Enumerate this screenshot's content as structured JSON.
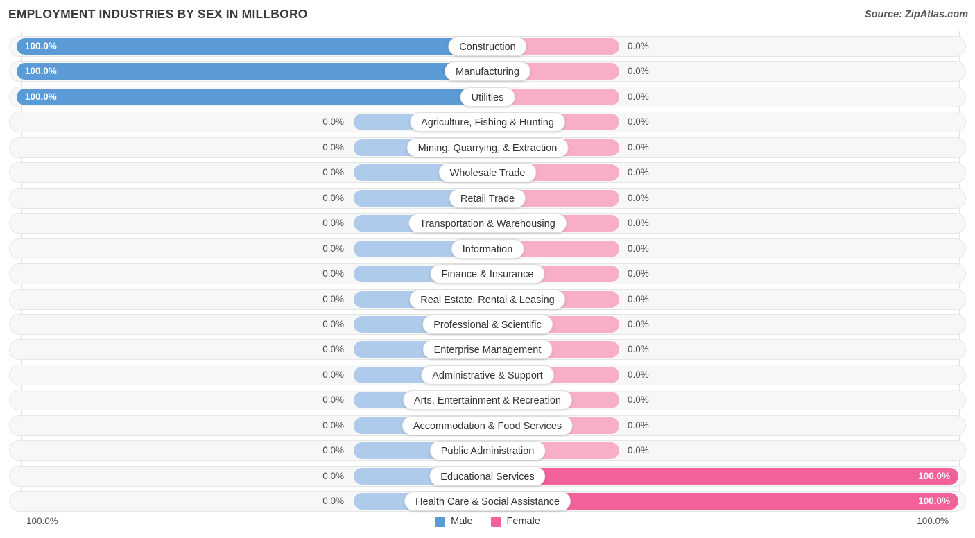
{
  "header": {
    "title": "EMPLOYMENT INDUSTRIES BY SEX IN MILLBORO",
    "source": "Source: ZipAtlas.com"
  },
  "legend": {
    "male_label": "Male",
    "female_label": "Female",
    "male_color": "#5b9bd5",
    "female_color": "#f2629a"
  },
  "footer": {
    "axis_left": "100.0%",
    "axis_right": "100.0%"
  },
  "chart_data": {
    "type": "bar",
    "subtype": "diverging-horizontal-bar",
    "title": "EMPLOYMENT INDUSTRIES BY SEX IN MILLBORO",
    "xlabel": "",
    "ylabel": "",
    "xlim": [
      100.0,
      100.0
    ],
    "grid": true,
    "legend_position": "bottom-center",
    "axis_extremes": [
      "100.0%",
      "100.0%"
    ],
    "categories": [
      "Construction",
      "Manufacturing",
      "Utilities",
      "Agriculture, Fishing & Hunting",
      "Mining, Quarrying, & Extraction",
      "Wholesale Trade",
      "Retail Trade",
      "Transportation & Warehousing",
      "Information",
      "Finance & Insurance",
      "Real Estate, Rental & Leasing",
      "Professional & Scientific",
      "Enterprise Management",
      "Administrative & Support",
      "Arts, Entertainment & Recreation",
      "Accommodation & Food Services",
      "Public Administration",
      "Educational Services",
      "Health Care & Social Assistance"
    ],
    "series": [
      {
        "name": "Male",
        "color": "#5b9bd5",
        "values": [
          100.0,
          100.0,
          100.0,
          0.0,
          0.0,
          0.0,
          0.0,
          0.0,
          0.0,
          0.0,
          0.0,
          0.0,
          0.0,
          0.0,
          0.0,
          0.0,
          0.0,
          0.0,
          0.0
        ]
      },
      {
        "name": "Female",
        "color": "#f2629a",
        "values": [
          0.0,
          0.0,
          0.0,
          0.0,
          0.0,
          0.0,
          0.0,
          0.0,
          0.0,
          0.0,
          0.0,
          0.0,
          0.0,
          0.0,
          0.0,
          0.0,
          0.0,
          100.0,
          100.0
        ]
      }
    ]
  },
  "rows": [
    {
      "label": "Construction",
      "male": "100.0%",
      "female": "0.0%",
      "male_value": 100.0,
      "female_value": 0.0
    },
    {
      "label": "Manufacturing",
      "male": "100.0%",
      "female": "0.0%",
      "male_value": 100.0,
      "female_value": 0.0
    },
    {
      "label": "Utilities",
      "male": "100.0%",
      "female": "0.0%",
      "male_value": 100.0,
      "female_value": 0.0
    },
    {
      "label": "Agriculture, Fishing & Hunting",
      "male": "0.0%",
      "female": "0.0%",
      "male_value": 0.0,
      "female_value": 0.0
    },
    {
      "label": "Mining, Quarrying, & Extraction",
      "male": "0.0%",
      "female": "0.0%",
      "male_value": 0.0,
      "female_value": 0.0
    },
    {
      "label": "Wholesale Trade",
      "male": "0.0%",
      "female": "0.0%",
      "male_value": 0.0,
      "female_value": 0.0
    },
    {
      "label": "Retail Trade",
      "male": "0.0%",
      "female": "0.0%",
      "male_value": 0.0,
      "female_value": 0.0
    },
    {
      "label": "Transportation & Warehousing",
      "male": "0.0%",
      "female": "0.0%",
      "male_value": 0.0,
      "female_value": 0.0
    },
    {
      "label": "Information",
      "male": "0.0%",
      "female": "0.0%",
      "male_value": 0.0,
      "female_value": 0.0
    },
    {
      "label": "Finance & Insurance",
      "male": "0.0%",
      "female": "0.0%",
      "male_value": 0.0,
      "female_value": 0.0
    },
    {
      "label": "Real Estate, Rental & Leasing",
      "male": "0.0%",
      "female": "0.0%",
      "male_value": 0.0,
      "female_value": 0.0
    },
    {
      "label": "Professional & Scientific",
      "male": "0.0%",
      "female": "0.0%",
      "male_value": 0.0,
      "female_value": 0.0
    },
    {
      "label": "Enterprise Management",
      "male": "0.0%",
      "female": "0.0%",
      "male_value": 0.0,
      "female_value": 0.0
    },
    {
      "label": "Administrative & Support",
      "male": "0.0%",
      "female": "0.0%",
      "male_value": 0.0,
      "female_value": 0.0
    },
    {
      "label": "Arts, Entertainment & Recreation",
      "male": "0.0%",
      "female": "0.0%",
      "male_value": 0.0,
      "female_value": 0.0
    },
    {
      "label": "Accommodation & Food Services",
      "male": "0.0%",
      "female": "0.0%",
      "male_value": 0.0,
      "female_value": 0.0
    },
    {
      "label": "Public Administration",
      "male": "0.0%",
      "female": "0.0%",
      "male_value": 0.0,
      "female_value": 0.0
    },
    {
      "label": "Educational Services",
      "male": "0.0%",
      "female": "100.0%",
      "male_value": 0.0,
      "female_value": 100.0
    },
    {
      "label": "Health Care & Social Assistance",
      "male": "0.0%",
      "female": "100.0%",
      "male_value": 0.0,
      "female_value": 100.0
    }
  ]
}
